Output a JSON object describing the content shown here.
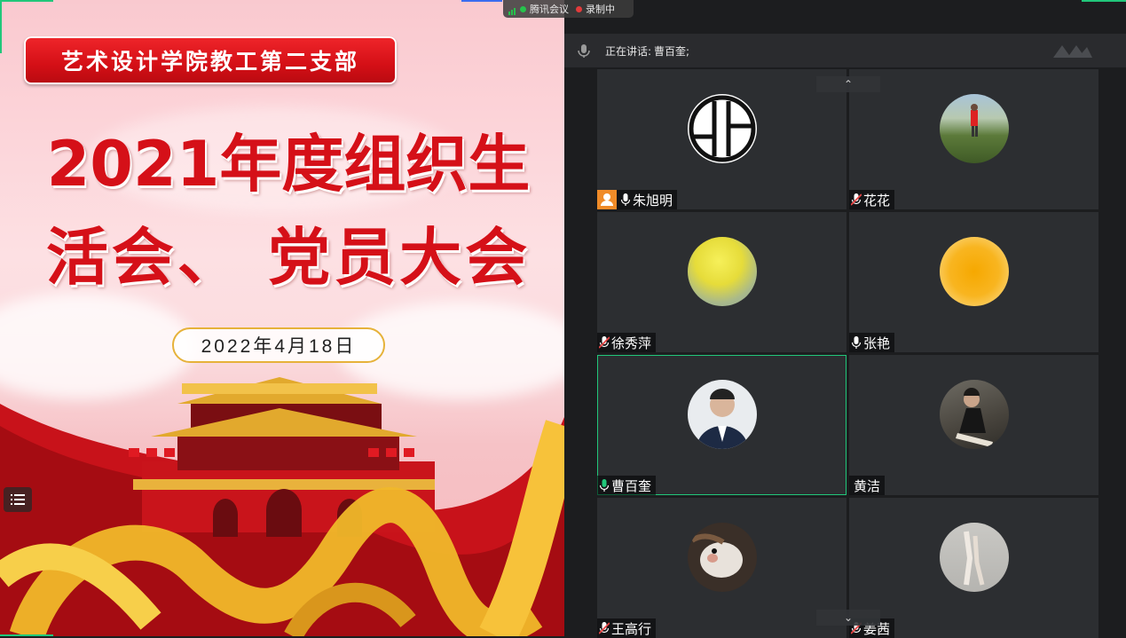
{
  "top_indicator": {
    "app_name": "腾讯会议",
    "recording": "录制中"
  },
  "slide": {
    "banner": "艺术设计学院教工第二支部",
    "title_line1": "2021年度组织生",
    "title_line2": "活会、 党员大会",
    "date": "2022年4月18日"
  },
  "panel": {
    "speaking_label": "正在讲话:",
    "speaking_name": "曹百奎;"
  },
  "participants": [
    {
      "name": "朱旭明",
      "mic": "on",
      "host": true,
      "avatar": "logo"
    },
    {
      "name": "花花",
      "mic": "muted",
      "host": false,
      "avatar": "photo-field"
    },
    {
      "name": "徐秀萍",
      "mic": "muted",
      "host": false,
      "avatar": "photo-balloons"
    },
    {
      "name": "张艳",
      "mic": "on",
      "host": false,
      "avatar": "sun-circle"
    },
    {
      "name": "曹百奎",
      "mic": "active",
      "host": false,
      "avatar": "photo-man"
    },
    {
      "name": "黄洁",
      "mic": "none",
      "host": false,
      "avatar": "photo-woman"
    },
    {
      "name": "王高行",
      "mic": "muted",
      "host": false,
      "avatar": "photo-dog"
    },
    {
      "name": "姜茜",
      "mic": "muted",
      "host": false,
      "avatar": "photo-hand"
    }
  ],
  "colors": {
    "accent_green": "#21c77a",
    "slide_red": "#d51018",
    "gold": "#e6b23a"
  }
}
